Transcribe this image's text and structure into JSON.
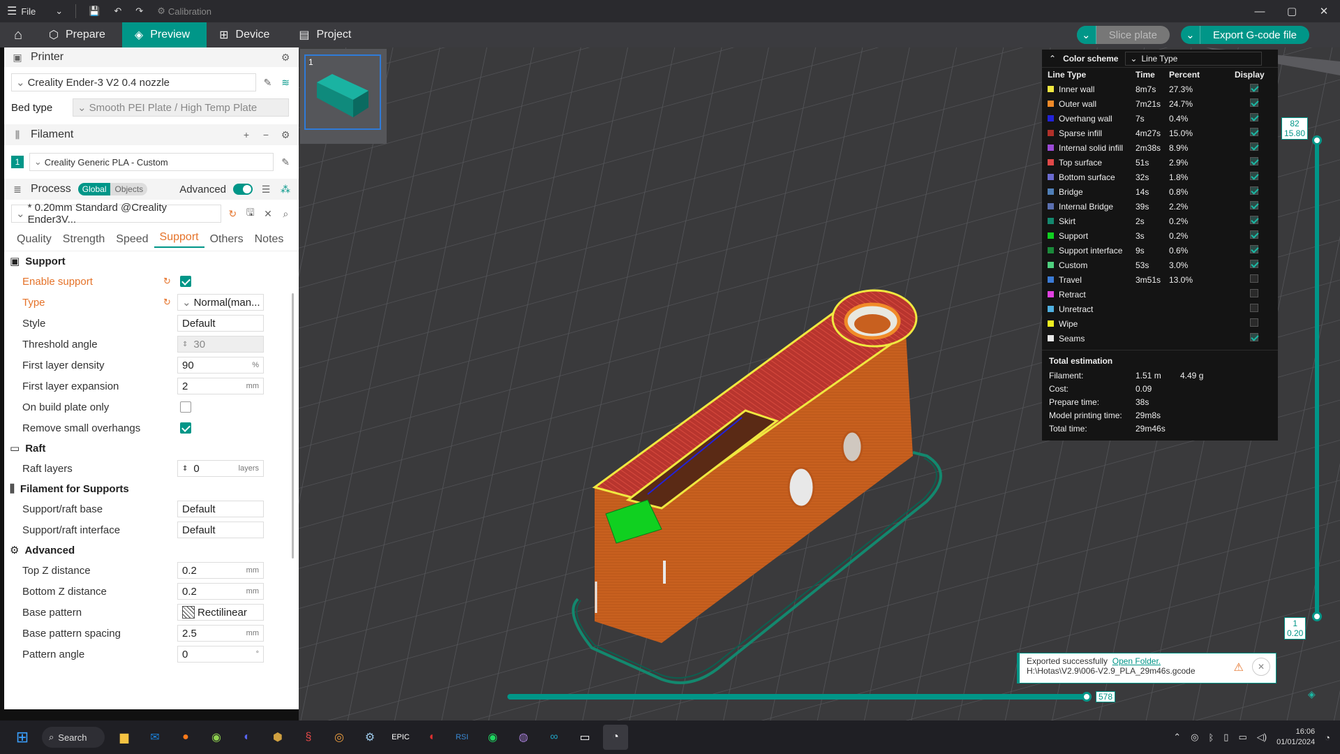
{
  "titlebar": {
    "file_label": "File",
    "calibration_label": "Calibration"
  },
  "nav": {
    "prepare": "Prepare",
    "preview": "Preview",
    "device": "Device",
    "project": "Project"
  },
  "actions": {
    "slice_plate": "Slice plate",
    "export_gcode": "Export G-code file"
  },
  "printer": {
    "section_label": "Printer",
    "selected": "Creality Ender-3 V2 0.4 nozzle",
    "bed_type_label": "Bed type",
    "bed_type_value": "Smooth PEI Plate / High Temp Plate"
  },
  "filament": {
    "section_label": "Filament",
    "slot_number": "1",
    "selected": "Creality Generic PLA - Custom"
  },
  "process": {
    "section_label": "Process",
    "global_label": "Global",
    "objects_label": "Objects",
    "advanced_label": "Advanced",
    "profile": "* 0.20mm Standard @Creality Ender3V...",
    "tabs": [
      "Quality",
      "Strength",
      "Speed",
      "Support",
      "Others",
      "Notes"
    ],
    "active_tab": "Support"
  },
  "support": {
    "section": "Support",
    "enable_support_label": "Enable support",
    "type_label": "Type",
    "type_value": "Normal(man...",
    "style_label": "Style",
    "style_value": "Default",
    "threshold_label": "Threshold angle",
    "threshold_value": "30",
    "first_layer_density_label": "First layer density",
    "first_layer_density_value": "90",
    "first_layer_density_unit": "%",
    "first_layer_expansion_label": "First layer expansion",
    "first_layer_expansion_value": "2",
    "mm_unit": "mm",
    "on_build_plate_label": "On build plate only",
    "remove_small_label": "Remove small overhangs"
  },
  "raft": {
    "section": "Raft",
    "raft_layers_label": "Raft layers",
    "raft_layers_value": "0",
    "raft_layers_unit": "layers"
  },
  "filament_supports": {
    "section": "Filament for Supports",
    "base_label": "Support/raft base",
    "base_value": "Default",
    "interface_label": "Support/raft interface",
    "interface_value": "Default"
  },
  "advanced": {
    "section": "Advanced",
    "top_z_label": "Top Z distance",
    "top_z_value": "0.2",
    "bottom_z_label": "Bottom Z distance",
    "bottom_z_value": "0.2",
    "base_pattern_label": "Base pattern",
    "base_pattern_value": "Rectilinear",
    "base_spacing_label": "Base pattern spacing",
    "base_spacing_value": "2.5",
    "pattern_angle_label": "Pattern angle",
    "pattern_angle_value": "0",
    "deg_unit": "°"
  },
  "legend": {
    "color_scheme_label": "Color scheme",
    "color_scheme_value": "Line Type",
    "col_type": "Line Type",
    "col_time": "Time",
    "col_percent": "Percent",
    "col_display": "Display",
    "rows": [
      {
        "name": "Inner wall",
        "time": "8m7s",
        "percent": "27.3%",
        "color": "#f0e840",
        "display": true
      },
      {
        "name": "Outer wall",
        "time": "7m21s",
        "percent": "24.7%",
        "color": "#f08a28",
        "display": true
      },
      {
        "name": "Overhang wall",
        "time": "7s",
        "percent": "0.4%",
        "color": "#2222d8",
        "display": true
      },
      {
        "name": "Sparse infill",
        "time": "4m27s",
        "percent": "15.0%",
        "color": "#b03029",
        "display": true
      },
      {
        "name": "Internal solid infill",
        "time": "2m38s",
        "percent": "8.9%",
        "color": "#9b4ad6",
        "display": true
      },
      {
        "name": "Top surface",
        "time": "51s",
        "percent": "2.9%",
        "color": "#e04848",
        "display": true
      },
      {
        "name": "Bottom surface",
        "time": "32s",
        "percent": "1.8%",
        "color": "#6b6bd0",
        "display": true
      },
      {
        "name": "Bridge",
        "time": "14s",
        "percent": "0.8%",
        "color": "#4f7fb8",
        "display": true
      },
      {
        "name": "Internal Bridge",
        "time": "39s",
        "percent": "2.2%",
        "color": "#5a6fb0",
        "display": true
      },
      {
        "name": "Skirt",
        "time": "2s",
        "percent": "0.2%",
        "color": "#13886e",
        "display": true
      },
      {
        "name": "Support",
        "time": "3s",
        "percent": "0.2%",
        "color": "#10d020",
        "display": true
      },
      {
        "name": "Support interface",
        "time": "9s",
        "percent": "0.6%",
        "color": "#1a8a3a",
        "display": true
      },
      {
        "name": "Custom",
        "time": "53s",
        "percent": "3.0%",
        "color": "#4fd07f",
        "display": true
      },
      {
        "name": "Travel",
        "time": "3m51s",
        "percent": "13.0%",
        "color": "#3b7bd6",
        "display": false
      },
      {
        "name": "Retract",
        "time": "",
        "percent": "",
        "color": "#e040e0",
        "display": false
      },
      {
        "name": "Unretract",
        "time": "",
        "percent": "",
        "color": "#4fb0e0",
        "display": false
      },
      {
        "name": "Wipe",
        "time": "",
        "percent": "",
        "color": "#f0f020",
        "display": false
      },
      {
        "name": "Seams",
        "time": "",
        "percent": "",
        "color": "#e8e8e8",
        "display": true
      }
    ],
    "total_label": "Total estimation",
    "totals": [
      {
        "k": "Filament:",
        "v": "1.51 m",
        "v2": "4.49 g"
      },
      {
        "k": "Cost:",
        "v": "0.09",
        "v2": ""
      },
      {
        "k": "Prepare time:",
        "v": "38s",
        "v2": ""
      },
      {
        "k": "Model printing time:",
        "v": "29m8s",
        "v2": ""
      },
      {
        "k": "Total time:",
        "v": "29m46s",
        "v2": ""
      }
    ]
  },
  "layer_slider": {
    "top_layer": "82",
    "top_height": "15.80",
    "bottom_layer": "1",
    "bottom_height": "0.20"
  },
  "move_slider": {
    "value": "578"
  },
  "thumbnail": {
    "index": "1"
  },
  "toast": {
    "message": "Exported successfully",
    "link": "Open Folder.",
    "path": "H:\\Hotas\\V2.9\\006-V2.9_PLA_29m46s.gcode"
  },
  "taskbar": {
    "search_label": "Search",
    "time": "16:06",
    "date": "01/01/2024"
  }
}
